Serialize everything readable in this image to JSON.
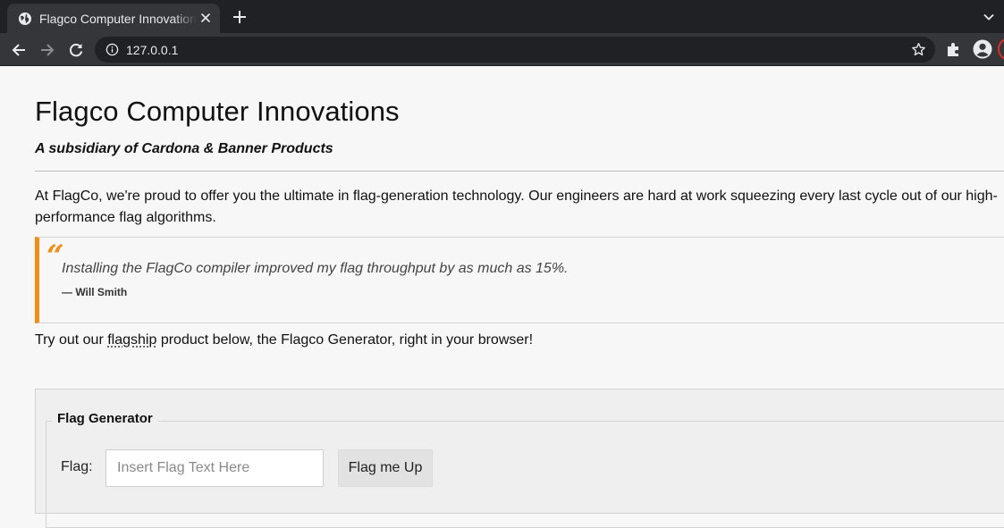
{
  "browser": {
    "tab_title": "Flagco Computer Innovations",
    "url": "127.0.0.1",
    "icons": {
      "tab_favicon": "globe-icon",
      "tab_close": "close-icon",
      "new_tab": "plus-icon",
      "tab_search": "chevron-down-icon",
      "back": "arrow-left-icon",
      "forward": "arrow-right-icon",
      "reload": "reload-icon",
      "site_info": "info-icon",
      "bookmark": "star-icon",
      "extensions": "puzzle-icon",
      "profile": "account-icon"
    },
    "colors": {
      "tabbar": "#202124",
      "toolbar": "#35363a"
    }
  },
  "page": {
    "title": "Flagco Computer Innovations",
    "subtitle": "A subsidiary of Cardona & Banner Products",
    "intro": "At FlagCo, we're proud to offer you the ultimate in flag-generation technology. Our engineers are hard at work squeezing every last cycle out of our high-performance flag algorithms.",
    "quote": {
      "mark": "“",
      "text": "Installing the FlagCo compiler improved my flag throughput by as much as 15%.",
      "author": "— Will Smith"
    },
    "tryout": {
      "before": "Try out our ",
      "abbr": "flagship",
      "after": " product below, the Flagco Generator, right in your browser!"
    },
    "generator": {
      "legend": "Flag Generator",
      "label": "Flag:",
      "input_value": "",
      "input_placeholder": "Insert Flag Text Here",
      "button_label": "Flag me Up"
    },
    "colors": {
      "accent": "#f28c13",
      "background": "#f7f7f7"
    }
  }
}
